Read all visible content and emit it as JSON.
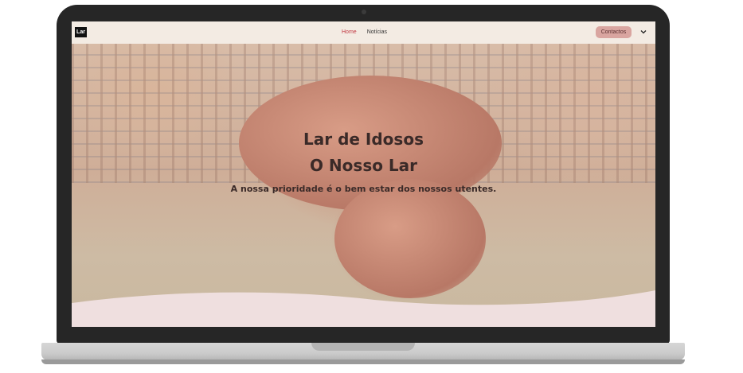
{
  "navbar": {
    "logo_text": "Lar",
    "links": [
      {
        "label": "Home",
        "active": true
      },
      {
        "label": "Notícias",
        "active": false
      }
    ],
    "contact_button": "Contactos",
    "menu_icon": "chevron-down-icon"
  },
  "hero": {
    "title_line1": "Lar de Idosos",
    "title_line2": "O Nosso Lar",
    "subtitle": "A nossa prioridade é o bem estar dos nossos utentes.",
    "image_description_icon": "elderly-hands-photo"
  },
  "colors": {
    "navbar_bg": "#f3ebe3",
    "active_link": "#c23a44",
    "contact_button_bg": "#d9a5a0",
    "wave_fill": "#efdfdf",
    "laptop_frame": "#262626"
  }
}
